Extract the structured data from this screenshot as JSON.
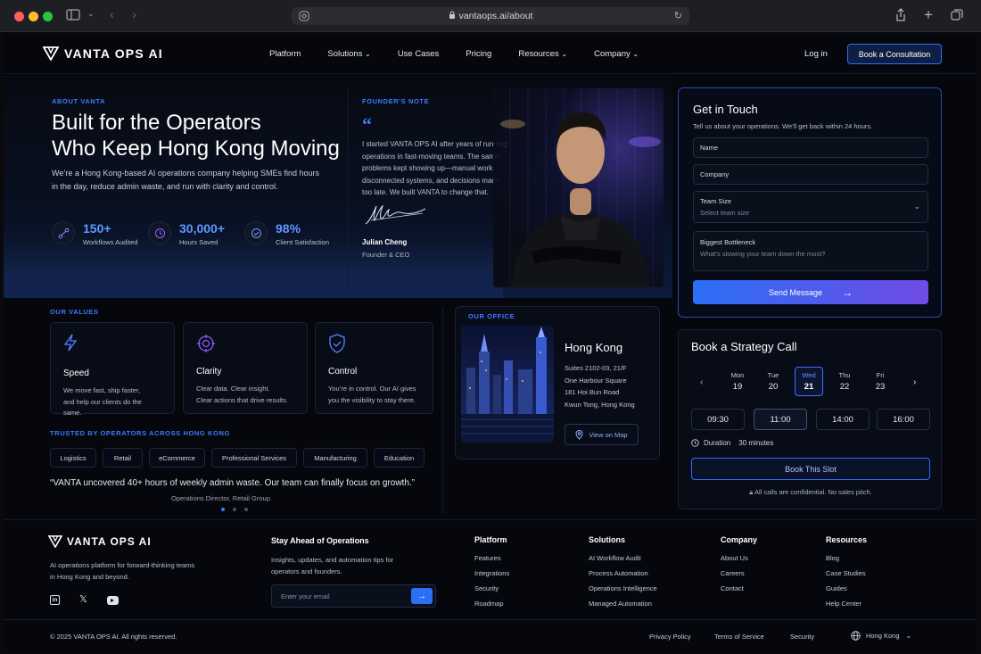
{
  "browser": {
    "url": "vantaops.ai/about"
  },
  "nav": {
    "brand": "VANTA OPS AI",
    "links": [
      "Platform",
      "Solutions",
      "Use Cases",
      "Pricing",
      "Resources",
      "Company"
    ],
    "login": "Log in",
    "cta": "Book a Consultation"
  },
  "hero": {
    "eyebrow": "ABOUT VANTA",
    "title_line1": "Built for the Operators",
    "title_line2": "Who Keep Hong Kong Moving",
    "subtitle": "We’re a Hong Kong-based AI operations company helping SMEs find hours in the day, reduce admin waste, and run with clarity and control.",
    "stats": [
      {
        "value": "150+",
        "label": "Workflows Audited",
        "icon": "workflow-icon"
      },
      {
        "value": "30,000+",
        "label": "Hours Saved",
        "icon": "clock-icon"
      },
      {
        "value": "98%",
        "label": "Client Satisfaction",
        "icon": "check-circle-icon"
      }
    ]
  },
  "founder": {
    "eyebrow": "FOUNDER'S NOTE",
    "quote": "I started VANTA OPS AI after years of running operations in fast-moving teams. The same problems kept showing up—manual work, disconnected systems, and decisions made too late. We built VANTA to change that.",
    "name": "Julian Cheng",
    "role": "Founder & CEO"
  },
  "contact": {
    "title": "Get in Touch",
    "subtitle": "Tell us about your operations. We’ll get back within 24 hours.",
    "name_label": "Name",
    "company_label": "Company",
    "team_label": "Team Size",
    "team_placeholder": "Select team size",
    "bottleneck_label": "Biggest Bottleneck",
    "bottleneck_placeholder": "What’s slowing your team down the most?",
    "send": "Send Message"
  },
  "booking": {
    "title": "Book a Strategy Call",
    "days": [
      {
        "dow": "Mon",
        "date": "19"
      },
      {
        "dow": "Tue",
        "date": "20"
      },
      {
        "dow": "Wed",
        "date": "21"
      },
      {
        "dow": "Thu",
        "date": "22"
      },
      {
        "dow": "Fri",
        "date": "23"
      }
    ],
    "selected_day": "Wed",
    "slots": [
      "09:30",
      "11:00",
      "14:00",
      "16:00"
    ],
    "selected_slot": "11:00",
    "duration_label": "Duration",
    "duration": "30 minutes",
    "book": "Book This Slot",
    "note": "All calls are confidential. No sales pitch."
  },
  "values": {
    "eyebrow": "OUR VALUES",
    "items": [
      {
        "title": "Speed",
        "desc1": "We move fast, ship faster,",
        "desc2": "and help our clients do the same.",
        "icon": "bolt-icon"
      },
      {
        "title": "Clarity",
        "desc1": "Clear data. Clear insight.",
        "desc2": "Clear actions that drive results.",
        "icon": "target-icon"
      },
      {
        "title": "Control",
        "desc1": "You’re in control. Our AI gives",
        "desc2": "you the visibility to stay there.",
        "icon": "shield-check-icon"
      }
    ]
  },
  "trusted": {
    "eyebrow": "TRUSTED BY OPERATORS ACROSS HONG KONG",
    "industries": [
      "Logistics",
      "Retail",
      "eCommerce",
      "Professional Services",
      "Manufacturing",
      "Education"
    ],
    "testimonial": "“VANTA uncovered 40+ hours of weekly admin waste. Our team can finally focus on growth.”",
    "attribution": "Operations Director, Retail Group"
  },
  "office": {
    "eyebrow": "OUR OFFICE",
    "city": "Hong Kong",
    "line1": "Suites 2102-03, 21/F",
    "line2": "One Harbour Square",
    "line3": "181 Hoi Bun Road",
    "line4": "Kwun Tong, Hong Kong",
    "map": "View on Map"
  },
  "footer": {
    "brand": "VANTA OPS AI",
    "tagline": "AI operations platform for forward-thinking teams in Hong Kong and beyond.",
    "newsletter_title": "Stay Ahead of Operations",
    "newsletter_desc": "Insights, updates, and automation tips for operators and founders.",
    "email_placeholder": "Enter your email",
    "columns": [
      {
        "title": "Platform",
        "items": [
          "Features",
          "Integrations",
          "Security",
          "Roadmap"
        ]
      },
      {
        "title": "Solutions",
        "items": [
          "AI Workflow Audit",
          "Process Automation",
          "Operations Intelligence",
          "Managed Automation"
        ]
      },
      {
        "title": "Company",
        "items": [
          "About Us",
          "Careers",
          "Contact"
        ]
      },
      {
        "title": "Resources",
        "items": [
          "Blog",
          "Case Studies",
          "Guides",
          "Help Center"
        ]
      }
    ],
    "copyright": "© 2025 VANTA OPS AI. All rights reserved.",
    "legal": [
      "Privacy Policy",
      "Terms of Service",
      "Security"
    ],
    "region": "Hong Kong"
  },
  "colors": {
    "accent": "#3d7bff",
    "gradient_end": "#6f4be6",
    "background": "#05070d"
  }
}
